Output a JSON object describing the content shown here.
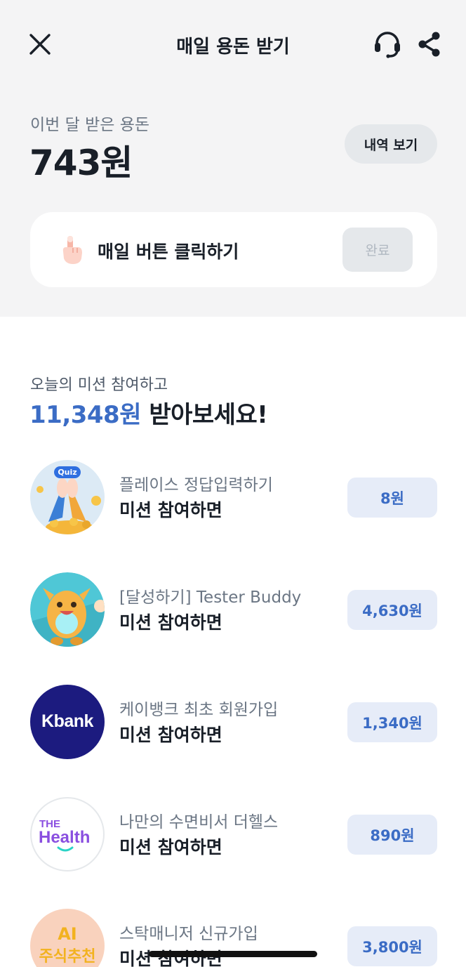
{
  "nav": {
    "title": "매일 용돈 받기"
  },
  "summary": {
    "month_label": "이번 달 받은 용돈",
    "month_amount": "743원",
    "history_button": "내역 보기"
  },
  "daily": {
    "label": "매일 버튼 클릭하기",
    "status_button": "완료"
  },
  "missions": {
    "subtitle": "오늘의 미션 참여하고",
    "headline_amount": "11,348원",
    "headline_suffix": " 받아보세요!",
    "items": [
      {
        "name": "플레이스 정답입력하기",
        "action": "미션 참여하면",
        "reward": "8원",
        "logo": "quiz-high-five-logo",
        "logo_text": "Quiz"
      },
      {
        "name": "[달성하기] Tester Buddy",
        "action": "미션 참여하면",
        "reward": "4,630원",
        "logo": "tester-buddy-character-logo"
      },
      {
        "name": "케이뱅크 최초 회원가입",
        "action": "미션 참여하면",
        "reward": "1,340원",
        "logo": "kbank-logo",
        "logo_text": "Kbank"
      },
      {
        "name": "나만의 수면비서 더헬스",
        "action": "미션 참여하면",
        "reward": "890원",
        "logo": "the-health-logo",
        "logo_text": [
          "THE",
          "Health"
        ]
      },
      {
        "name": "스탁매니저 신규가입",
        "action": "미션 참여하면",
        "reward": "3,800원",
        "logo": "ai-stock-logo",
        "logo_text": [
          "AI",
          "주식추천"
        ]
      }
    ]
  },
  "colors": {
    "accent": "#3b6cc5",
    "reward_bg": "#e6ecf8",
    "top_bg": "#f4f4f5",
    "kbank": "#1c1b7f",
    "the_health": "#8a4fe0"
  }
}
